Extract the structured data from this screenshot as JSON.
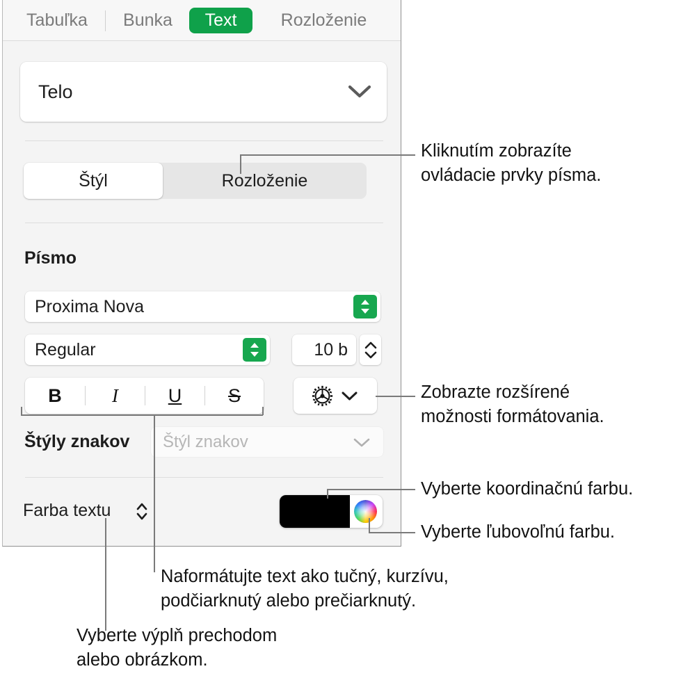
{
  "panel": {
    "tabs": [
      {
        "label": "Tabuľka",
        "active": false
      },
      {
        "label": "Bunka",
        "active": false
      },
      {
        "label": "Text",
        "active": true
      },
      {
        "label": "Rozloženie",
        "active": false
      }
    ],
    "paragraph_style": {
      "value": "Telo",
      "icon": "chevron-down-icon"
    },
    "segmented": {
      "options": [
        "Štýl",
        "Rozloženie"
      ],
      "selected": "Štýl"
    },
    "font_section": {
      "title": "Písmo",
      "family": "Proxima Nova",
      "weight": "Regular",
      "size": "10 b",
      "family_icon": "up-down-stepper-icon",
      "weight_icon": "up-down-stepper-icon",
      "size_icon": "up-down-stepper-icon"
    },
    "typeface_buttons": [
      {
        "label": "B",
        "name": "bold"
      },
      {
        "label": "I",
        "name": "italic"
      },
      {
        "label": "U",
        "name": "underline"
      },
      {
        "label": "S",
        "name": "strikethrough"
      }
    ],
    "advanced_options": {
      "icon": "gear-icon",
      "chevron": "chevron-down-icon"
    },
    "character_styles": {
      "label": "Štýly znakov",
      "placeholder": "Štýl znakov",
      "icon": "chevron-down-icon"
    },
    "text_color": {
      "label": "Farba textu",
      "icon": "up-down-chevron-icon",
      "swatch_color": "#000000",
      "wheel_icon": "color-wheel-icon"
    },
    "accent_color": "#0fa14a"
  },
  "callouts": [
    {
      "id": "font-controls",
      "text": "Kliknutím zobrazíte\novládacie prvky písma."
    },
    {
      "id": "advanced-format",
      "text": "Zobrazte rozšírené\nmožnosti formátovania."
    },
    {
      "id": "coordinated-color",
      "text": "Vyberte koordinačnú farbu."
    },
    {
      "id": "any-color",
      "text": "Vyberte ľubovoľnú farbu."
    },
    {
      "id": "text-formatting",
      "text": "Naformátujte text ako tučný, kurzívu,\npodčiarknutý alebo prečiarknutý."
    },
    {
      "id": "gradient-fill",
      "text": "Vyberte výplň prechodom\nalebo obrázkom."
    }
  ]
}
